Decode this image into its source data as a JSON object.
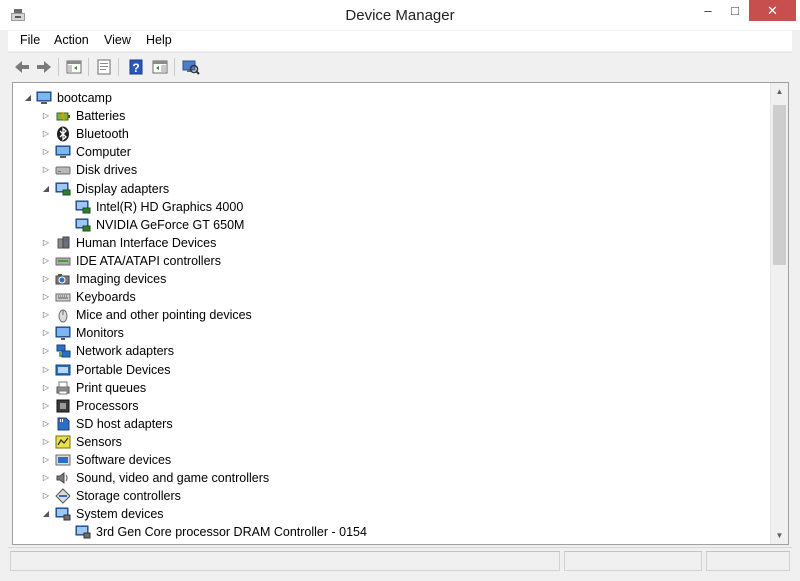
{
  "window": {
    "title": "Device Manager",
    "controls": {
      "minimize": "–",
      "maximize": "□",
      "close": "✕"
    }
  },
  "menu": [
    "File",
    "Action",
    "View",
    "Help"
  ],
  "toolbar": {
    "buttons": [
      "back-arrow-icon",
      "forward-arrow-icon",
      "show-hide-tree-icon",
      "properties-icon",
      "help-icon",
      "update-driver-icon",
      "scan-hardware-icon"
    ]
  },
  "tree": {
    "root": {
      "label": "bootcamp",
      "icon": "computer-icon",
      "expanded": true
    },
    "items": [
      {
        "label": "Batteries",
        "icon": "battery-icon",
        "expanded": false
      },
      {
        "label": "Bluetooth",
        "icon": "bluetooth-icon",
        "expanded": false
      },
      {
        "label": "Computer",
        "icon": "computer-icon",
        "expanded": false
      },
      {
        "label": "Disk drives",
        "icon": "disk-drive-icon",
        "expanded": false
      },
      {
        "label": "Display adapters",
        "icon": "display-adapter-icon",
        "expanded": true,
        "children": [
          {
            "label": "Intel(R) HD Graphics 4000",
            "icon": "display-adapter-icon"
          },
          {
            "label": "NVIDIA GeForce GT 650M",
            "icon": "display-adapter-icon"
          }
        ]
      },
      {
        "label": "Human Interface Devices",
        "icon": "hid-icon",
        "expanded": false
      },
      {
        "label": "IDE ATA/ATAPI controllers",
        "icon": "ide-controller-icon",
        "expanded": false
      },
      {
        "label": "Imaging devices",
        "icon": "camera-icon",
        "expanded": false
      },
      {
        "label": "Keyboards",
        "icon": "keyboard-icon",
        "expanded": false
      },
      {
        "label": "Mice and other pointing devices",
        "icon": "mouse-icon",
        "expanded": false
      },
      {
        "label": "Monitors",
        "icon": "monitor-icon",
        "expanded": false
      },
      {
        "label": "Network adapters",
        "icon": "network-adapter-icon",
        "expanded": false
      },
      {
        "label": "Portable Devices",
        "icon": "portable-device-icon",
        "expanded": false
      },
      {
        "label": "Print queues",
        "icon": "printer-icon",
        "expanded": false
      },
      {
        "label": "Processors",
        "icon": "processor-icon",
        "expanded": false
      },
      {
        "label": "SD host adapters",
        "icon": "sd-card-icon",
        "expanded": false
      },
      {
        "label": "Sensors",
        "icon": "sensor-icon",
        "expanded": false
      },
      {
        "label": "Software devices",
        "icon": "software-device-icon",
        "expanded": false
      },
      {
        "label": "Sound, video and game controllers",
        "icon": "speaker-icon",
        "expanded": false
      },
      {
        "label": "Storage controllers",
        "icon": "storage-controller-icon",
        "expanded": false
      },
      {
        "label": "System devices",
        "icon": "system-device-icon",
        "expanded": true,
        "children": [
          {
            "label": "3rd Gen Core processor DRAM Controller - 0154",
            "icon": "system-device-icon"
          }
        ]
      }
    ]
  },
  "colors": {
    "close_button": "#c7504f",
    "window_bg": "#f0f0f0",
    "tree_bg": "#ffffff",
    "device_icon_blue": "#1f5fa8"
  }
}
